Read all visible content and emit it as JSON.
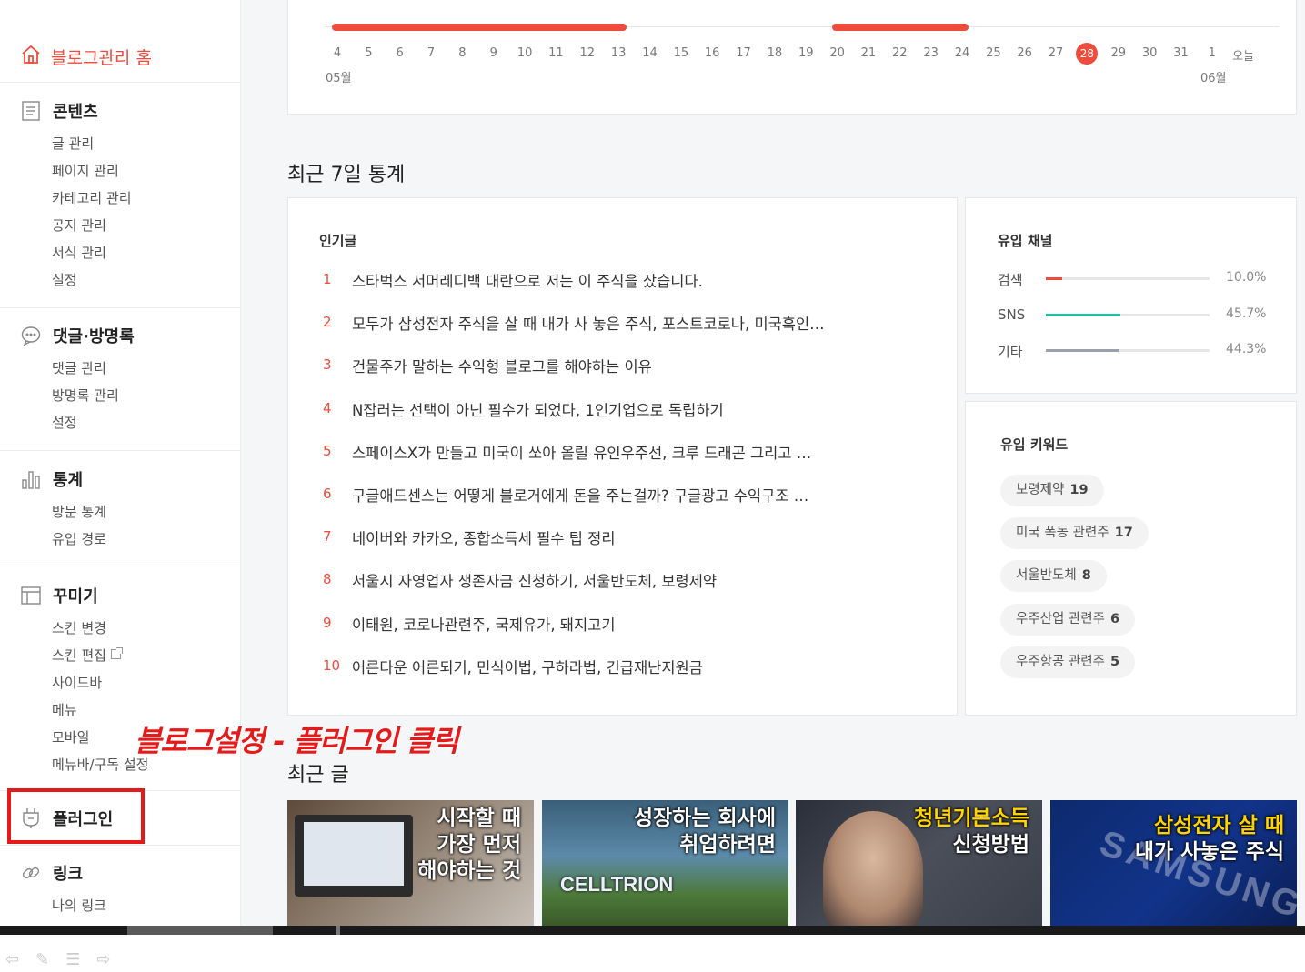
{
  "sidebar": {
    "home_label": "블로그관리 홈",
    "sections": [
      {
        "title": "콘텐츠",
        "icon": "document-icon",
        "items": [
          "글 관리",
          "페이지 관리",
          "카테고리 관리",
          "공지 관리",
          "서식 관리",
          "설정"
        ]
      },
      {
        "title": "댓글·방명록",
        "icon": "comment-icon",
        "items": [
          "댓글 관리",
          "방명록 관리",
          "설정"
        ]
      },
      {
        "title": "통계",
        "icon": "bar-chart-icon",
        "items": [
          "방문 통계",
          "유입 경로"
        ]
      },
      {
        "title": "꾸미기",
        "icon": "layout-icon",
        "items": [
          "스킨 변경",
          "스킨 편집",
          "사이드바",
          "메뉴",
          "모바일",
          "메뉴바/구독 설정"
        ]
      },
      {
        "title": "플러그인",
        "icon": "plug-icon",
        "items": []
      },
      {
        "title": "링크",
        "icon": "link-icon",
        "items": [
          "나의 링크"
        ]
      }
    ]
  },
  "chart": {
    "days": [
      "4",
      "5",
      "6",
      "7",
      "8",
      "9",
      "10",
      "11",
      "12",
      "13",
      "14",
      "15",
      "16",
      "17",
      "18",
      "19",
      "20",
      "21",
      "22",
      "23",
      "24",
      "25",
      "26",
      "27",
      "28",
      "29",
      "30",
      "31",
      "1",
      "오늘"
    ],
    "today_index": 24,
    "month_start": "05월",
    "month_end": "06월",
    "accent_color": "#f04b3b"
  },
  "stats": {
    "title": "최근 7일 통계",
    "popular": {
      "label": "인기글",
      "items": [
        {
          "num": "1",
          "text": "스타벅스 서머레디백 대란으로 저는 이 주식을 샀습니다."
        },
        {
          "num": "2",
          "text": "모두가 삼성전자 주식을 살 때 내가 사 놓은 주식, 포스트코로나, 미국흑인…"
        },
        {
          "num": "3",
          "text": "건물주가 말하는 수익형 블로그를 해야하는 이유"
        },
        {
          "num": "4",
          "text": "N잡러는 선택이 아닌 필수가 되었다, 1인기업으로 독립하기"
        },
        {
          "num": "5",
          "text": "스페이스X가 만들고 미국이 쏘아 올릴 유인우주선, 크루 드래곤 그리고 …"
        },
        {
          "num": "6",
          "text": "구글애드센스는 어떻게 블로거에게 돈을 주는걸까? 구글광고 수익구조 …"
        },
        {
          "num": "7",
          "text": "네이버와 카카오, 종합소득세 필수 팁 정리"
        },
        {
          "num": "8",
          "text": "서울시 자영업자 생존자금 신청하기, 서울반도체, 보령제약"
        },
        {
          "num": "9",
          "text": "이태원, 코로나관련주, 국제유가, 돼지고기"
        },
        {
          "num": "10",
          "text": "어른다운 어른되기, 민식이법, 구하라법, 긴급재난지원금"
        }
      ]
    },
    "inflow": {
      "label": "유입 채널",
      "rows": [
        {
          "name": "검색",
          "pct": "10.0%",
          "value": 10.0,
          "color": "#f04b3b"
        },
        {
          "name": "SNS",
          "pct": "45.7%",
          "value": 45.7,
          "color": "#1fc0a7"
        },
        {
          "name": "기타",
          "pct": "44.3%",
          "value": 44.3,
          "color": "#9aa0aa"
        }
      ]
    },
    "keywords": {
      "label": "유입 키워드",
      "items": [
        {
          "word": "보령제약",
          "count": "19"
        },
        {
          "word": "미국 폭동 관련주",
          "count": "17"
        },
        {
          "word": "서울반도체",
          "count": "8"
        },
        {
          "word": "우주산업 관련주",
          "count": "6"
        },
        {
          "word": "우주항공 관련주",
          "count": "5"
        }
      ]
    }
  },
  "recent": {
    "title": "최근 글",
    "thumbnails": [
      {
        "lines": [
          "시작할 때",
          "가장 먼저",
          "해야하는 것"
        ]
      },
      {
        "lines": [
          "성장하는 회사에",
          "취업하려면"
        ],
        "badge": "CELLTRION"
      },
      {
        "lines_yellow": [
          "청년기본소득"
        ],
        "lines": [
          "신청방법"
        ]
      },
      {
        "lines_yellow": [
          "삼성전자 살 때"
        ],
        "lines": [
          "내가 사놓은 주식"
        ]
      }
    ]
  },
  "annotation": "블로그설정 - 플러그인 클릭"
}
